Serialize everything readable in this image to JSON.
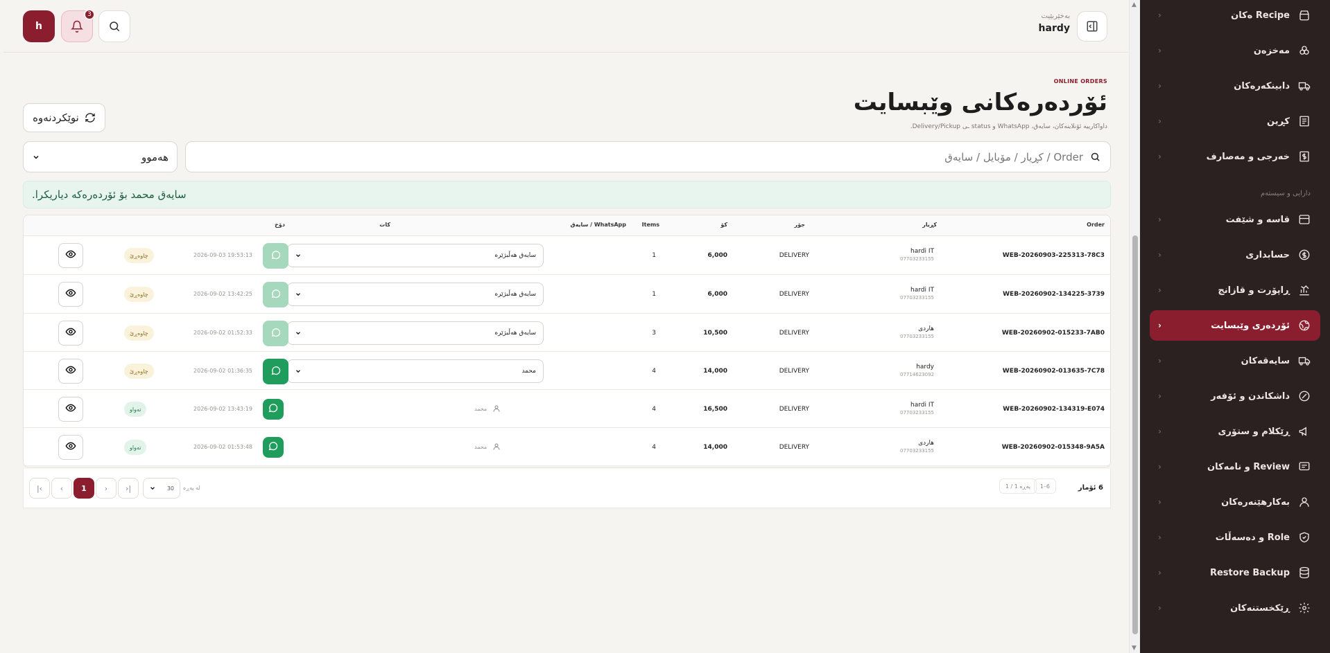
{
  "header": {
    "user_caption": "بەخێربێیت",
    "user_name": "hardy",
    "avatar_letter": "h",
    "notification_count": "3"
  },
  "page": {
    "eyebrow": "ONLINE ORDERS",
    "title": "ئۆردەرەکانی وێبسایت",
    "subtitle": "داواکارییە ئۆنلاینەکان، سایەق، WhatsApp و status ـی Delivery/Pickup.",
    "refresh_label": "نوێکردنەوە"
  },
  "filters": {
    "search_placeholder": "Order / کڕیار / مۆبایل / سایەق",
    "status_value": "هەموو"
  },
  "alert": {
    "message": "سایەق محمد بۆ ئۆردەرەکە دیاریکرا."
  },
  "table": {
    "columns": {
      "order": "Order",
      "customer": "کڕیار",
      "type": "جۆر",
      "amount": "کۆ",
      "items": "Items",
      "driver_whatsapp": "سایەق / WhatsApp",
      "time": "کات",
      "status": "دۆخ"
    },
    "rows": [
      {
        "order": "WEB-20260903-225313-78C3",
        "customer": "hardi IT",
        "phone": "07703233155",
        "type": "DELIVERY",
        "amount": "6,000",
        "items": "1",
        "driver": "سایەق هەڵبژێرە",
        "driver_mode": "select",
        "wa": "light",
        "time": "2026-09-03 19:53:13",
        "status": "چاوەڕێ",
        "status_kind": "pending"
      },
      {
        "order": "WEB-20260902-134225-3739",
        "customer": "hardi IT",
        "phone": "07703233155",
        "type": "DELIVERY",
        "amount": "6,000",
        "items": "1",
        "driver": "سایەق هەڵبژێرە",
        "driver_mode": "select",
        "wa": "light",
        "time": "2026-09-02 13:42:25",
        "status": "چاوەڕێ",
        "status_kind": "pending"
      },
      {
        "order": "WEB-20260902-015233-7AB0",
        "customer": "هاردی",
        "phone": "07703233155",
        "type": "DELIVERY",
        "amount": "10,500",
        "items": "3",
        "driver": "سایەق هەڵبژێرە",
        "driver_mode": "select",
        "wa": "light",
        "time": "2026-09-02 01:52:33",
        "status": "چاوەڕێ",
        "status_kind": "pending"
      },
      {
        "order": "WEB-20260902-013635-7C78",
        "customer": "hardy",
        "phone": "07714623092",
        "type": "DELIVERY",
        "amount": "14,000",
        "items": "4",
        "driver": "محمد",
        "driver_mode": "select",
        "wa": "dark",
        "time": "2026-09-02 01:36:35",
        "status": "چاوەڕێ",
        "status_kind": "pending"
      },
      {
        "order": "WEB-20260902-134319-E074",
        "customer": "hardi IT",
        "phone": "07703233155",
        "type": "DELIVERY",
        "amount": "16,500",
        "items": "4",
        "driver": "محمد",
        "driver_mode": "text",
        "wa": "dark",
        "time": "2026-09-02 13:43:19",
        "status": "تەواو",
        "status_kind": "done"
      },
      {
        "order": "WEB-20260902-015348-9A5A",
        "customer": "هاردی",
        "phone": "07703233155",
        "type": "DELIVERY",
        "amount": "14,000",
        "items": "4",
        "driver": "محمد",
        "driver_mode": "text",
        "wa": "dark",
        "time": "2026-09-02 01:53:48",
        "status": "تەواو",
        "status_kind": "done"
      }
    ]
  },
  "pagination": {
    "total": "6 ئۆمار",
    "range": "1–6",
    "page_of": "پەڕە 1 / 1",
    "current_page": "1",
    "per_page": "30",
    "per_page_label": "لە پەڕە"
  },
  "sidebar": {
    "section_label": "دارایی و سیستەم",
    "items": [
      {
        "label": "Recipe ەکان",
        "icon": "recipe-icon"
      },
      {
        "label": "مەخزەن",
        "icon": "boxes-icon"
      },
      {
        "label": "دابینکەرەکان",
        "icon": "truck-icon"
      },
      {
        "label": "کڕین",
        "icon": "receipt-icon"
      },
      {
        "label": "خەرجی و مەصارف",
        "icon": "money-icon"
      },
      {
        "label": "قاسە و شێفت",
        "icon": "cashbox-icon"
      },
      {
        "label": "حسابداری",
        "icon": "dollar-icon"
      },
      {
        "label": "ڕاپۆرت و قازانج",
        "icon": "chart-icon"
      },
      {
        "label": "ئۆردەری وێبسایت",
        "icon": "globe-icon"
      },
      {
        "label": "سایەقەکان",
        "icon": "delivery-truck-icon"
      },
      {
        "label": "داشکاندن و ئۆفەر",
        "icon": "discount-icon"
      },
      {
        "label": "ڕێکلام و ستۆری",
        "icon": "megaphone-icon"
      },
      {
        "label": "Review و نامەکان",
        "icon": "message-icon"
      },
      {
        "label": "بەکارهێنەرەکان",
        "icon": "user-icon"
      },
      {
        "label": "Role و دەسەڵات",
        "icon": "shield-icon"
      },
      {
        "label": "Restore Backup",
        "icon": "database-icon"
      },
      {
        "label": "ڕێکخستنەکان",
        "icon": "gear-icon"
      }
    ],
    "active_index": 8
  },
  "colors": {
    "brand": "#8a1e2e",
    "sidebar_bg": "#2a2120",
    "whatsapp": "#1f9d5c",
    "success_bg": "#e7f5ee"
  }
}
